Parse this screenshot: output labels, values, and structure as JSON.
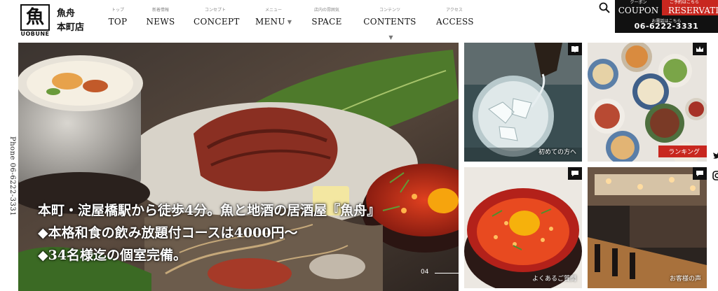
{
  "brand": {
    "logo_kanji": "魚",
    "logo_text": "UOBUNE",
    "shop_name_line1": "魚舟",
    "shop_name_line2": "本町店"
  },
  "nav": [
    {
      "jp": "トップ",
      "en": "TOP",
      "has_caret": false
    },
    {
      "jp": "新着情報",
      "en": "NEWS",
      "has_caret": false
    },
    {
      "jp": "コンセプト",
      "en": "CONCEPT",
      "has_caret": false
    },
    {
      "jp": "メニュー",
      "en": "MENU",
      "has_caret": true
    },
    {
      "jp": "店内の雰囲気",
      "en": "SPACE",
      "has_caret": false
    },
    {
      "jp": "コンテンツ",
      "en": "CONTENTS",
      "has_caret": true
    },
    {
      "jp": "アクセス",
      "en": "ACCESS",
      "has_caret": false
    }
  ],
  "nav_caret": "▼",
  "header_actions": {
    "search_icon": "search-icon",
    "coupon_small": "クーポン",
    "coupon_label": "COUPON",
    "reservation_small": "ご予約はこちら",
    "reservation_label": "RESERVATION",
    "tel_caption": "お電話はこちら",
    "tel_number": "06-6222-3331"
  },
  "side_phone": "Phone 06-6222-3331",
  "hero": {
    "line1": "本町・淀屋橋駅から徒歩4分。魚と地酒の居酒屋『魚舟』",
    "line2": "◆本格和食の飲み放題付コースは4000円～",
    "line3": "◆34名様迄の個室完備。",
    "page_indicator": "04"
  },
  "tiles": [
    {
      "label": "初めての方へ",
      "badge_icon": "book-icon"
    },
    {
      "label": "ランキング",
      "badge_icon": "crown-icon"
    },
    {
      "label": "よくあるご質問",
      "badge_icon": "chat-icon"
    },
    {
      "label": "お客様の声",
      "badge_icon": "chat-icon"
    }
  ],
  "social_icons": [
    "twitter-icon",
    "instagram-icon"
  ],
  "colors": {
    "accent_red": "#c8271f",
    "header_black": "#111111"
  }
}
